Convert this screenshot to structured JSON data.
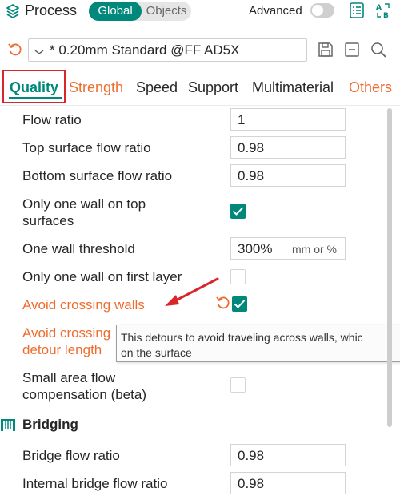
{
  "header": {
    "title": "Process",
    "mode_global": "Global",
    "mode_objects": "Objects",
    "advanced_label": "Advanced",
    "advanced_enabled": false
  },
  "preset": {
    "name": "* 0.20mm Standard @FF AD5X"
  },
  "tabs": [
    {
      "label": "Quality",
      "state": "active"
    },
    {
      "label": "Strength",
      "state": "modified"
    },
    {
      "label": "Speed",
      "state": "normal"
    },
    {
      "label": "Support",
      "state": "normal"
    },
    {
      "label": "Multimaterial",
      "state": "normal"
    },
    {
      "label": "Others",
      "state": "modified"
    }
  ],
  "settings": {
    "flow_ratio": {
      "label": "Flow ratio",
      "value": "1"
    },
    "top_surface_flow_ratio": {
      "label": "Top surface flow ratio",
      "value": "0.98"
    },
    "bottom_surface_flow_ratio": {
      "label": "Bottom surface flow ratio",
      "value": "0.98"
    },
    "only_one_wall_top": {
      "label_line1": "Only one wall on top",
      "label_line2": "surfaces",
      "checked": true
    },
    "one_wall_threshold": {
      "label": "One wall threshold",
      "value": "300%",
      "unit": "mm or %"
    },
    "only_one_wall_first_layer": {
      "label": "Only one wall on first layer",
      "checked": false
    },
    "avoid_crossing_walls": {
      "label": "Avoid crossing walls",
      "checked": true
    },
    "avoid_crossing_max_detour": {
      "label_line1": "Avoid crossing",
      "label_line2": "detour length"
    },
    "small_area_flow_comp": {
      "label_line1": "Small area flow",
      "label_line2": "compensation (beta)",
      "checked": false
    }
  },
  "tooltip": {
    "line1": "This detours to avoid traveling across walls, whic",
    "line2": "on the surface"
  },
  "bridging": {
    "title": "Bridging",
    "bridge_flow_ratio": {
      "label": "Bridge flow ratio",
      "value": "0.98"
    },
    "internal_bridge_flow_ratio": {
      "label": "Internal bridge flow ratio",
      "value": "0.98"
    }
  },
  "colors": {
    "accent": "#00897b",
    "modified": "#ef6c2e",
    "annotation": "#d9262b"
  },
  "icons": [
    "process-icon",
    "compare-list-icon",
    "compare-presets-icon",
    "undo-icon",
    "chevron-down-icon",
    "save-icon",
    "delete-icon",
    "search-icon",
    "reset-icon",
    "bridge-icon"
  ]
}
